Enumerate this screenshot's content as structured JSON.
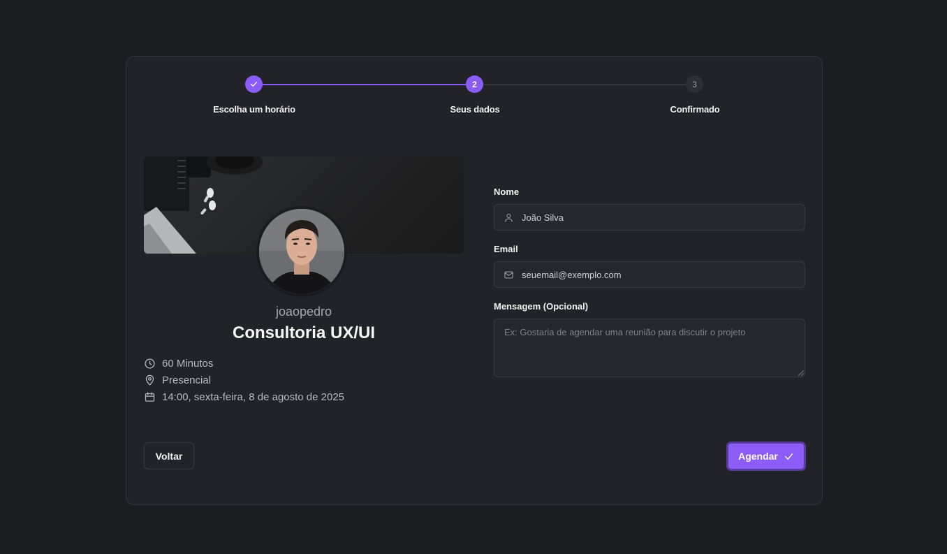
{
  "stepper": {
    "steps": [
      {
        "label": "Escolha um horário",
        "state": "done"
      },
      {
        "label": "Seus dados",
        "number": "2",
        "state": "active"
      },
      {
        "label": "Confirmado",
        "number": "3",
        "state": "pending"
      }
    ]
  },
  "profile": {
    "username": "joaopedro",
    "service_title": "Consultoria UX/UI",
    "details": {
      "duration": "60 Minutos",
      "location": "Presencial",
      "datetime": "14:00, sexta-feira, 8 de agosto de 2025"
    }
  },
  "form": {
    "name_label": "Nome",
    "name_value": "João Silva",
    "email_label": "Email",
    "email_value": "seuemail@exemplo.com",
    "message_label": "Mensagem (Opcional)",
    "message_placeholder": "Ex: Gostaria de agendar uma reunião para discutir o projeto"
  },
  "actions": {
    "back_label": "Voltar",
    "submit_label": "Agendar"
  },
  "colors": {
    "accent": "#8b5cf6",
    "background": "#1c1d21",
    "card": "#222328"
  }
}
